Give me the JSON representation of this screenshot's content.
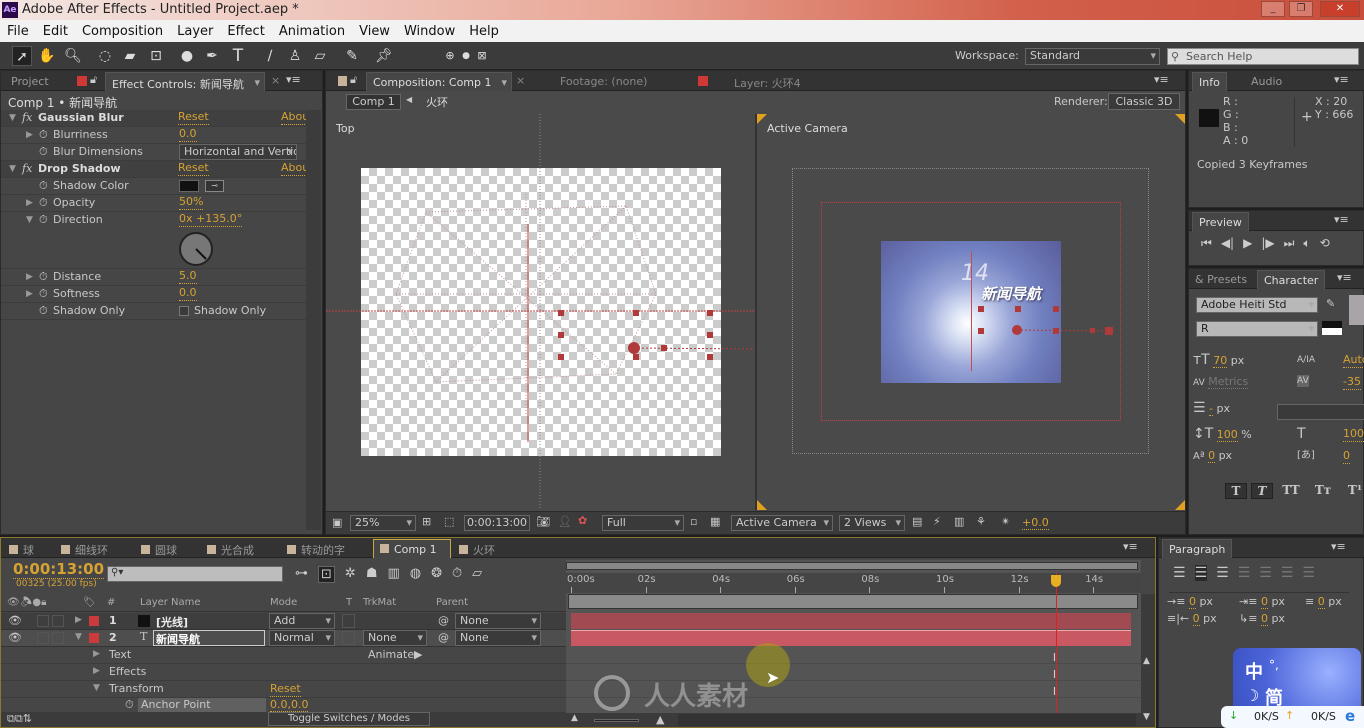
{
  "app": {
    "logo": "Ae",
    "title": "Adobe After Effects - Untitled Project.aep *",
    "window_buttons": [
      "_",
      "❐",
      "✕"
    ]
  },
  "menu": [
    "File",
    "Edit",
    "Composition",
    "Layer",
    "Effect",
    "Animation",
    "View",
    "Window",
    "Help"
  ],
  "toolbar": {
    "tools": [
      "selection-tool",
      "hand-tool",
      "zoom-tool",
      "rotate-tool",
      "camera-tool",
      "pan-behind-tool",
      "ellipse-tool",
      "pen-tool",
      "type-tool",
      "brush-tool",
      "clone-stamp-tool",
      "eraser-tool",
      "roto-brush-tool",
      "puppet-pin-tool"
    ],
    "workspace_label": "Workspace:",
    "workspace_value": "Standard",
    "search_placeholder": "Search Help"
  },
  "effect_controls": {
    "tabs": {
      "project": "Project",
      "effect": "Effect Controls: 新闻导航"
    },
    "breadcrumb": "Comp 1 • 新闻导航",
    "effects": [
      {
        "name": "Gaussian Blur",
        "reset": "Reset",
        "about": "Abou",
        "props": [
          {
            "label": "Blurriness",
            "value": "0.0"
          },
          {
            "label": "Blur Dimensions",
            "value": "Horizontal and Vertical"
          }
        ]
      },
      {
        "name": "Drop Shadow",
        "reset": "Reset",
        "about": "Abou",
        "props": [
          {
            "label": "Shadow Color",
            "value": "#111111"
          },
          {
            "label": "Opacity",
            "value": "50%"
          },
          {
            "label": "Direction",
            "value": "0x +135.0°"
          },
          {
            "label": "Distance",
            "value": "5.0"
          },
          {
            "label": "Softness",
            "value": "0.0"
          },
          {
            "label": "Shadow Only",
            "value": "Shadow Only",
            "checked": false
          }
        ]
      }
    ]
  },
  "composition": {
    "tabs": {
      "comp": "Composition: Comp 1",
      "footage": "Footage: (none)",
      "layer": "Layer: 火环4"
    },
    "breadcrumbs": [
      "Comp 1",
      "火环"
    ],
    "renderer_label": "Renderer:",
    "renderer_value": "Classic 3D",
    "views": {
      "left": "Top",
      "right": "Active Camera"
    },
    "title_text": "新闻导航",
    "overlay_num": "14",
    "footer": {
      "zoom": "25%",
      "timecode": "0:00:13:00",
      "resolution": "Full",
      "camera": "Active Camera",
      "views": "2 Views",
      "exposure": "+0.0"
    }
  },
  "info": {
    "tabs": [
      "Info",
      "Audio"
    ],
    "r": "R :",
    "g": "G :",
    "b": "B :",
    "a": "A : 0",
    "x": "X : 20",
    "y": "Y : 666",
    "message": "Copied 3 Keyframes"
  },
  "preview": {
    "tab": "Preview",
    "buttons": [
      "first-frame",
      "prev-frame",
      "play",
      "next-frame",
      "last-frame",
      "audio",
      "loop"
    ]
  },
  "character": {
    "tabs": [
      "& Presets",
      "Character"
    ],
    "font": "Adobe Heiti Std",
    "style": "R",
    "size": "70",
    "size_unit": "px",
    "leading": "Auto",
    "kerning": "Metrics",
    "tracking": "-35",
    "stroke": "-",
    "stroke_unit": "px",
    "vscale": "100",
    "hscale": "100",
    "pct": "%",
    "baseline": "0",
    "baseline_unit": "px",
    "tsume": "0",
    "styles": [
      "T",
      "T",
      "TT",
      "Tт",
      "T¹",
      "T₁"
    ]
  },
  "paragraph": {
    "tab": "Paragraph",
    "indents": [
      {
        "v": "0",
        "u": "px"
      },
      {
        "v": "0",
        "u": "px"
      },
      {
        "v": "0",
        "u": "px"
      },
      {
        "v": "0",
        "u": "px"
      },
      {
        "v": "0",
        "u": "px"
      }
    ]
  },
  "timeline": {
    "tabs": [
      "球",
      "细线环",
      "圆球",
      "光合成",
      "转动的字",
      "Comp 1",
      "火环"
    ],
    "active_tab": 5,
    "timecode": "0:00:13:00",
    "frames": "00325 (25.00 fps)",
    "columns": {
      "num": "#",
      "name": "Layer Name",
      "mode": "Mode",
      "t": "T",
      "trkmat": "TrkMat",
      "parent": "Parent"
    },
    "layers": [
      {
        "num": "1",
        "name": "[光线]",
        "mode": "Add",
        "trkmat": "",
        "parent": "None"
      },
      {
        "num": "2",
        "name": "新闻导航",
        "mode": "Normal",
        "trkmat": "None",
        "parent": "None"
      }
    ],
    "props": [
      {
        "label": "Text"
      },
      {
        "label": "Effects"
      },
      {
        "label": "Transform",
        "reset": "Reset"
      },
      {
        "label": "Anchor Point",
        "value": "0.0,0.0"
      }
    ],
    "animate_label": "Animate:",
    "ruler": [
      "0:00s",
      "02s",
      "04s",
      "06s",
      "08s",
      "10s",
      "12s",
      "14s"
    ],
    "current_time_s": 13,
    "toggle_label": "Toggle Switches / Modes"
  },
  "watermark": "人人素材",
  "taskbar": {
    "ime_top": "中",
    "ime_punct": "°,",
    "ime_bottom": "简",
    "down": "0K/S",
    "up": "0K/S"
  },
  "colors": {
    "accent": "#d6a233",
    "label_red": "#cc3b3b",
    "playhead": "#e02020",
    "layer_bar": "#c0505a"
  }
}
